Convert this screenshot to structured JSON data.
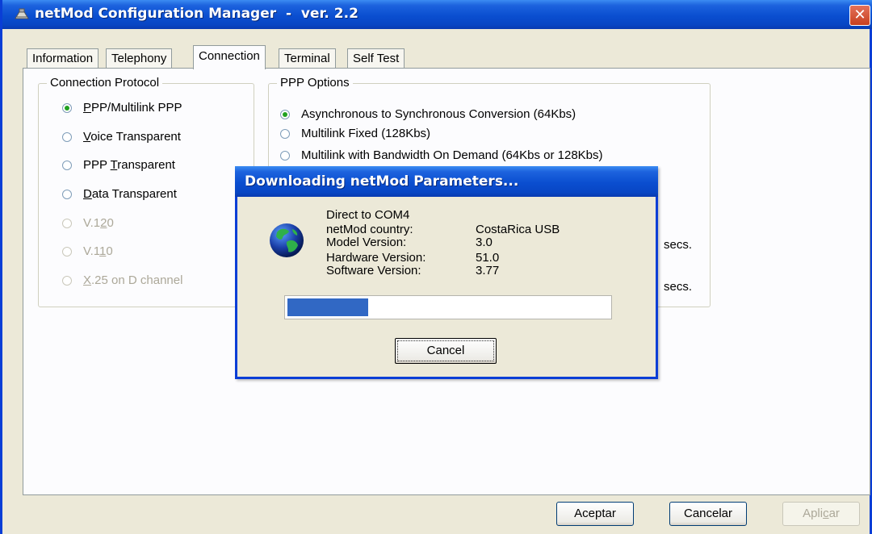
{
  "window": {
    "title": "netMod Configuration Manager  -  ver. 2.2",
    "close_glyph": "✕"
  },
  "tabs": [
    {
      "label": "Information"
    },
    {
      "label": "Telephony"
    },
    {
      "label": "Connection",
      "active": true
    },
    {
      "label": "Terminal"
    },
    {
      "label": "Self Test"
    }
  ],
  "connection_protocol": {
    "title": "Connection Protocol",
    "options": [
      {
        "pre": "",
        "acc": "P",
        "post": "PP/Multilink PPP",
        "checked": true,
        "enabled": true
      },
      {
        "pre": "",
        "acc": "V",
        "post": "oice Transparent",
        "checked": false,
        "enabled": true
      },
      {
        "pre": "PPP ",
        "acc": "T",
        "post": "ransparent",
        "checked": false,
        "enabled": true
      },
      {
        "pre": "",
        "acc": "D",
        "post": "ata Transparent",
        "checked": false,
        "enabled": true
      },
      {
        "pre": "V.1",
        "acc": "2",
        "post": "0",
        "checked": false,
        "enabled": false
      },
      {
        "pre": "V.1",
        "acc": "1",
        "post": "0",
        "checked": false,
        "enabled": false
      },
      {
        "pre": "",
        "acc": "X",
        "post": ".25 on D channel",
        "checked": false,
        "enabled": false
      }
    ]
  },
  "ppp_options": {
    "title": "PPP Options",
    "options": [
      {
        "label": "Asynchronous to Synchronous Conversion (64Kbs)",
        "checked": true
      },
      {
        "label": "Multilink Fixed (128Kbs)",
        "checked": false
      },
      {
        "label": "Multilink with Bandwidth On Demand (64Kbs or 128Kbs)",
        "checked": false
      }
    ],
    "unit_1": "secs.",
    "unit_2": "secs."
  },
  "buttons": {
    "ok": "Aceptar",
    "cancel": "Cancelar",
    "apply_pre": "Apli",
    "apply_acc": "c",
    "apply_post": "ar"
  },
  "dialog": {
    "title": "Downloading netMod Parameters...",
    "connection": "Direct to COM4",
    "rows": [
      {
        "label": "netMod country:",
        "value": "CostaRica USB"
      },
      {
        "label": "Model Version:",
        "value": "3.0"
      },
      {
        "label": "Hardware Version:",
        "value": "51.0"
      },
      {
        "label": "Software Version:",
        "value": "3.77"
      }
    ],
    "progress": 0.25,
    "cancel_label": "Cancel",
    "icon": "globe-icon"
  },
  "colors": {
    "titlebar": "#0a4ed0",
    "progress": "#3168c4",
    "radio_check": "#21a121"
  }
}
